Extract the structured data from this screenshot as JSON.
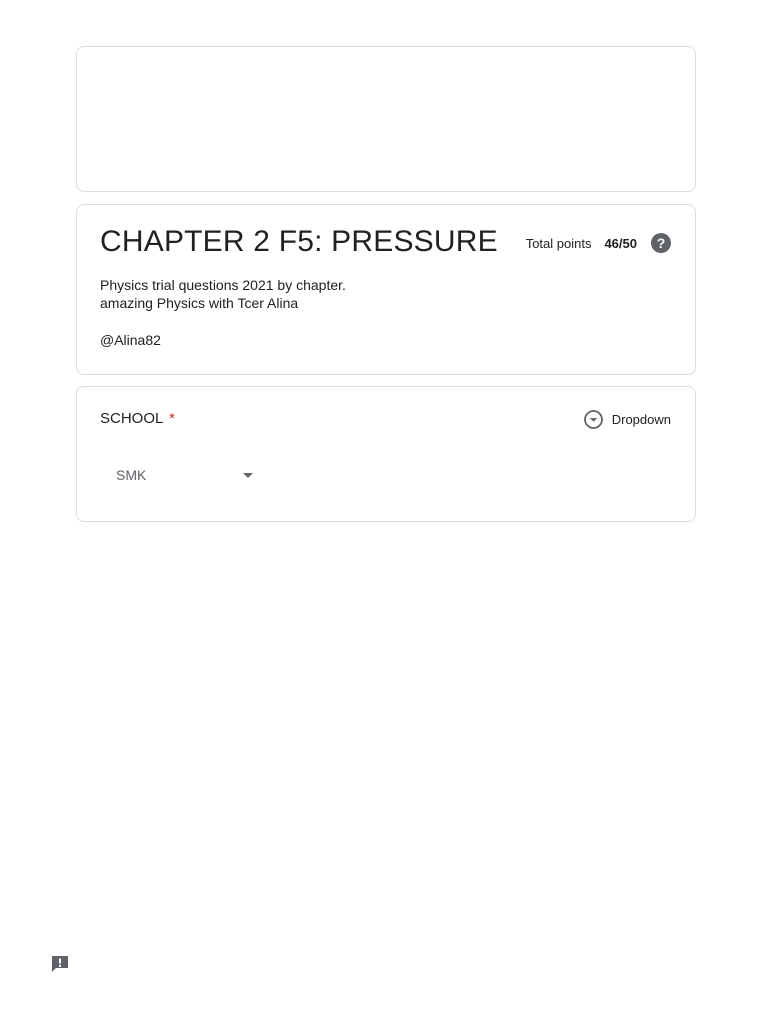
{
  "form": {
    "title": "CHAPTER 2 F5: PRESSURE",
    "total_points_label": "Total points",
    "total_points_value": "46/50",
    "help_icon_glyph": "?",
    "description_line1": "Physics trial questions 2021 by chapter.",
    "description_line2": "amazing Physics with Tcer Alina",
    "description_line3": "@Alina82"
  },
  "question": {
    "title": "SCHOOL",
    "required_mark": "*",
    "type_label": "Dropdown",
    "selected_value": "SMK"
  },
  "icons": {
    "help": "help-icon",
    "dropdown_type": "dropdown-circle-icon",
    "caret": "caret-down-icon",
    "feedback": "report-feedback-icon"
  },
  "colors": {
    "required": "#d93025",
    "border": "#dadce0",
    "icon_gray": "#5f6368",
    "text": "#202124"
  }
}
